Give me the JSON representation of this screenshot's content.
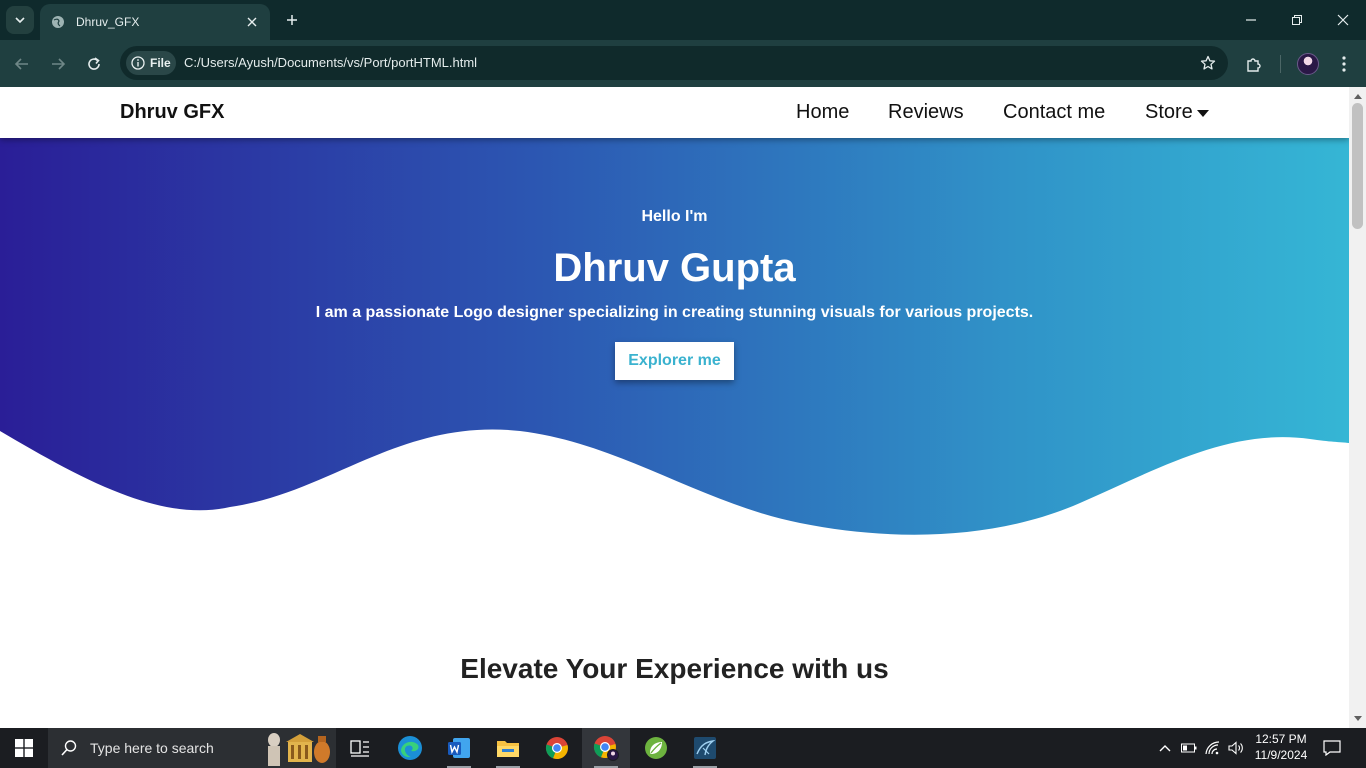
{
  "browser": {
    "tab_title": "Dhruv_GFX",
    "site_chip": "File",
    "url": "C:/Users/Ayush/Documents/vs/Port/portHTML.html"
  },
  "site": {
    "brand": "Dhruv GFX",
    "nav": [
      {
        "label": "Home"
      },
      {
        "label": "Reviews"
      },
      {
        "label": "Contact me"
      },
      {
        "label": "Store"
      }
    ],
    "hero": {
      "greeting": "Hello I'm",
      "name": "Dhruv Gupta",
      "description": "I am a passionate Logo designer specializing in creating stunning visuals for various projects.",
      "button": "Explorer me"
    },
    "section_heading": "Elevate Your Experience with us",
    "colors": {
      "gradient_start": "#2a1e97",
      "gradient_end": "#35b6d5",
      "button_text": "#3ab2cf"
    }
  },
  "taskbar": {
    "search_placeholder": "Type here to search",
    "time": "12:57 PM",
    "date": "11/9/2024",
    "apps": [
      "task-view",
      "edge",
      "word",
      "file-explorer",
      "chrome",
      "chrome-profile",
      "spring-tool-suite",
      "mysql-workbench"
    ]
  }
}
